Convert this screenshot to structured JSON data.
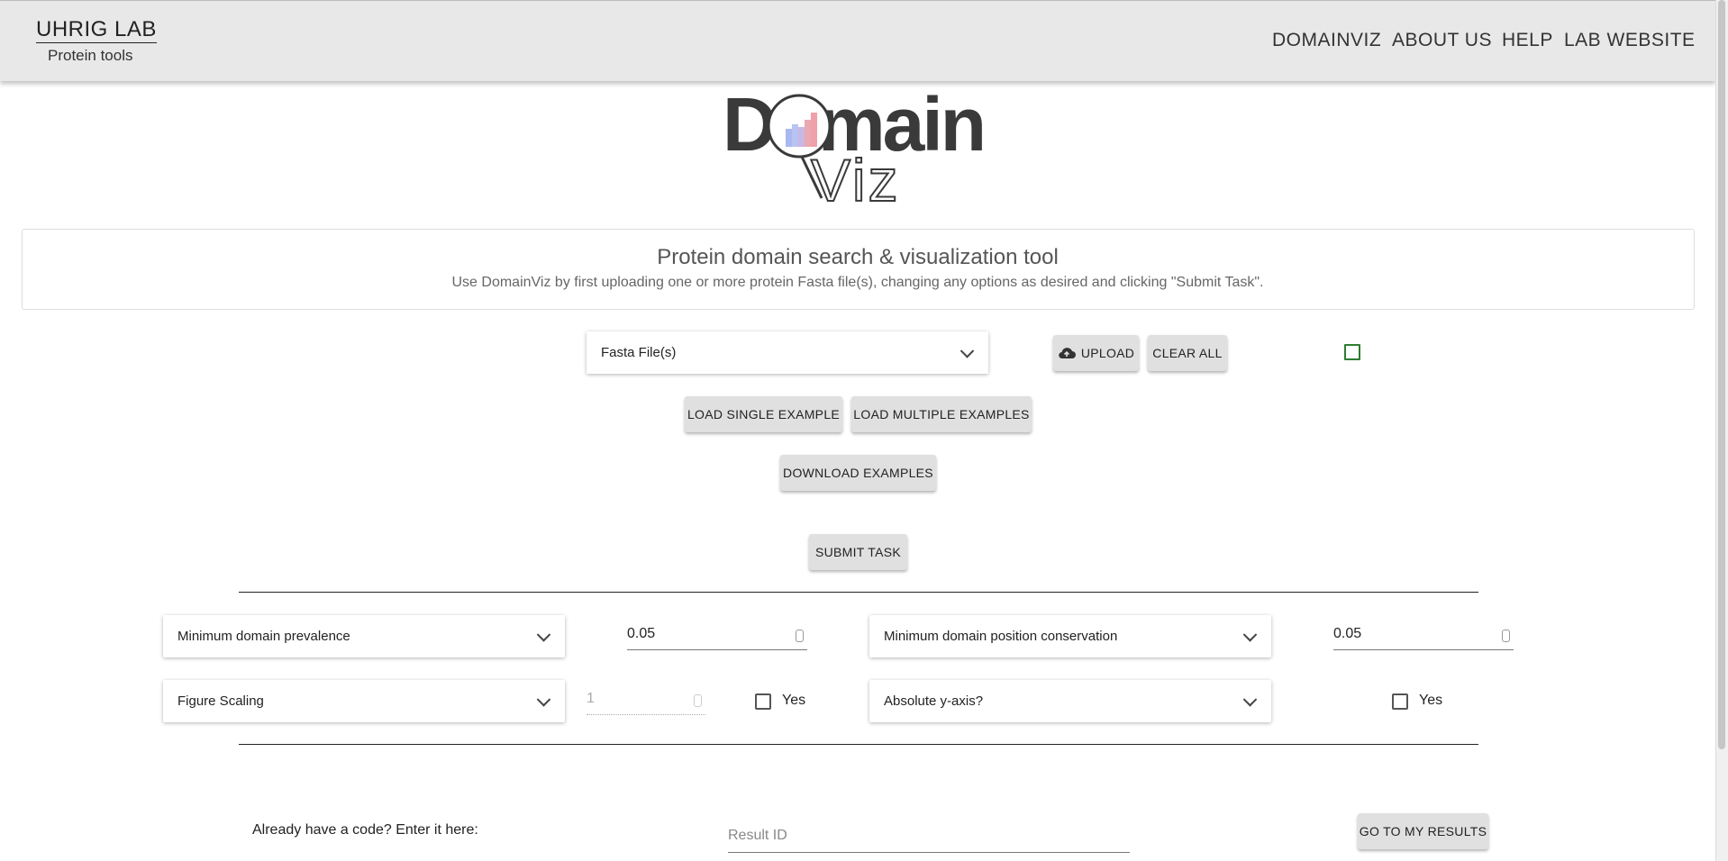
{
  "header": {
    "brand_title": "UHRIG LAB",
    "brand_subtitle": "Protein tools",
    "nav": [
      "DOMAINVIZ",
      "ABOUT US",
      "HELP",
      "LAB WEBSITE"
    ]
  },
  "logo": {
    "part1": "Domain",
    "part2": "Viz"
  },
  "intro": {
    "title": "Protein domain search & visualization tool",
    "description": "Use DomainViz by first uploading one or more protein Fasta file(s), changing any options as desired and clicking \"Submit Task\"."
  },
  "upload": {
    "fasta_select": "Fasta File(s)",
    "upload_label": "UPLOAD",
    "clear_label": "CLEAR ALL"
  },
  "examples": {
    "load_single": "LOAD SINGLE EXAMPLE",
    "load_multiple": "LOAD MULTIPLE EXAMPLES",
    "download": "DOWNLOAD EXAMPLES"
  },
  "submit_label": "SUBMIT TASK",
  "options": {
    "prevalence_label": "Minimum domain prevalence",
    "prevalence_value": "0.05",
    "conservation_label": "Minimum domain position conservation",
    "conservation_value": "0.05",
    "scaling_label": "Figure Scaling",
    "scaling_value": "1",
    "scaling_yes": "Yes",
    "absolute_label": "Absolute y-axis?",
    "absolute_yes": "Yes"
  },
  "results": {
    "prompt": "Already have a code? Enter it here:",
    "placeholder": "Result ID",
    "go_label": "GO TO MY RESULTS"
  },
  "colors": {
    "header_bg": "#e8e8e8",
    "checkbox_accent": "#2e7d32",
    "button_bg": "#e0e0e0"
  }
}
